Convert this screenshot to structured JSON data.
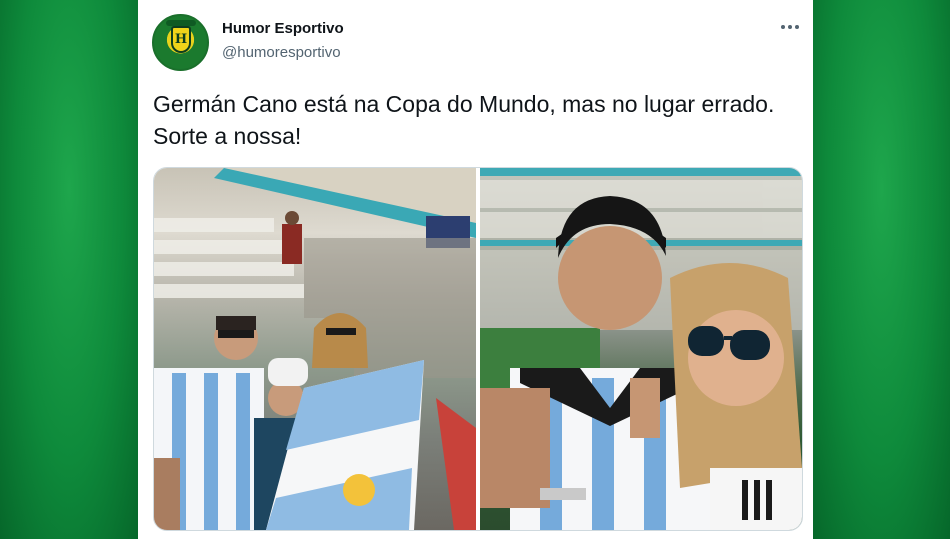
{
  "tweet": {
    "author_name": "Humor Esportivo",
    "author_handle": "@humoresportivo",
    "avatar_initials": "H",
    "text": "Germán Cano está na Copa do Mundo, mas no lugar errado. Sorte a nossa!"
  },
  "media": [
    {
      "description_icon": "photo-icon"
    },
    {
      "description_icon": "photo-icon"
    }
  ],
  "colors": {
    "background_green": "#0d7f37",
    "text_primary": "#0f1419",
    "text_secondary": "#536471",
    "argentina_blue": "#75aadb"
  }
}
